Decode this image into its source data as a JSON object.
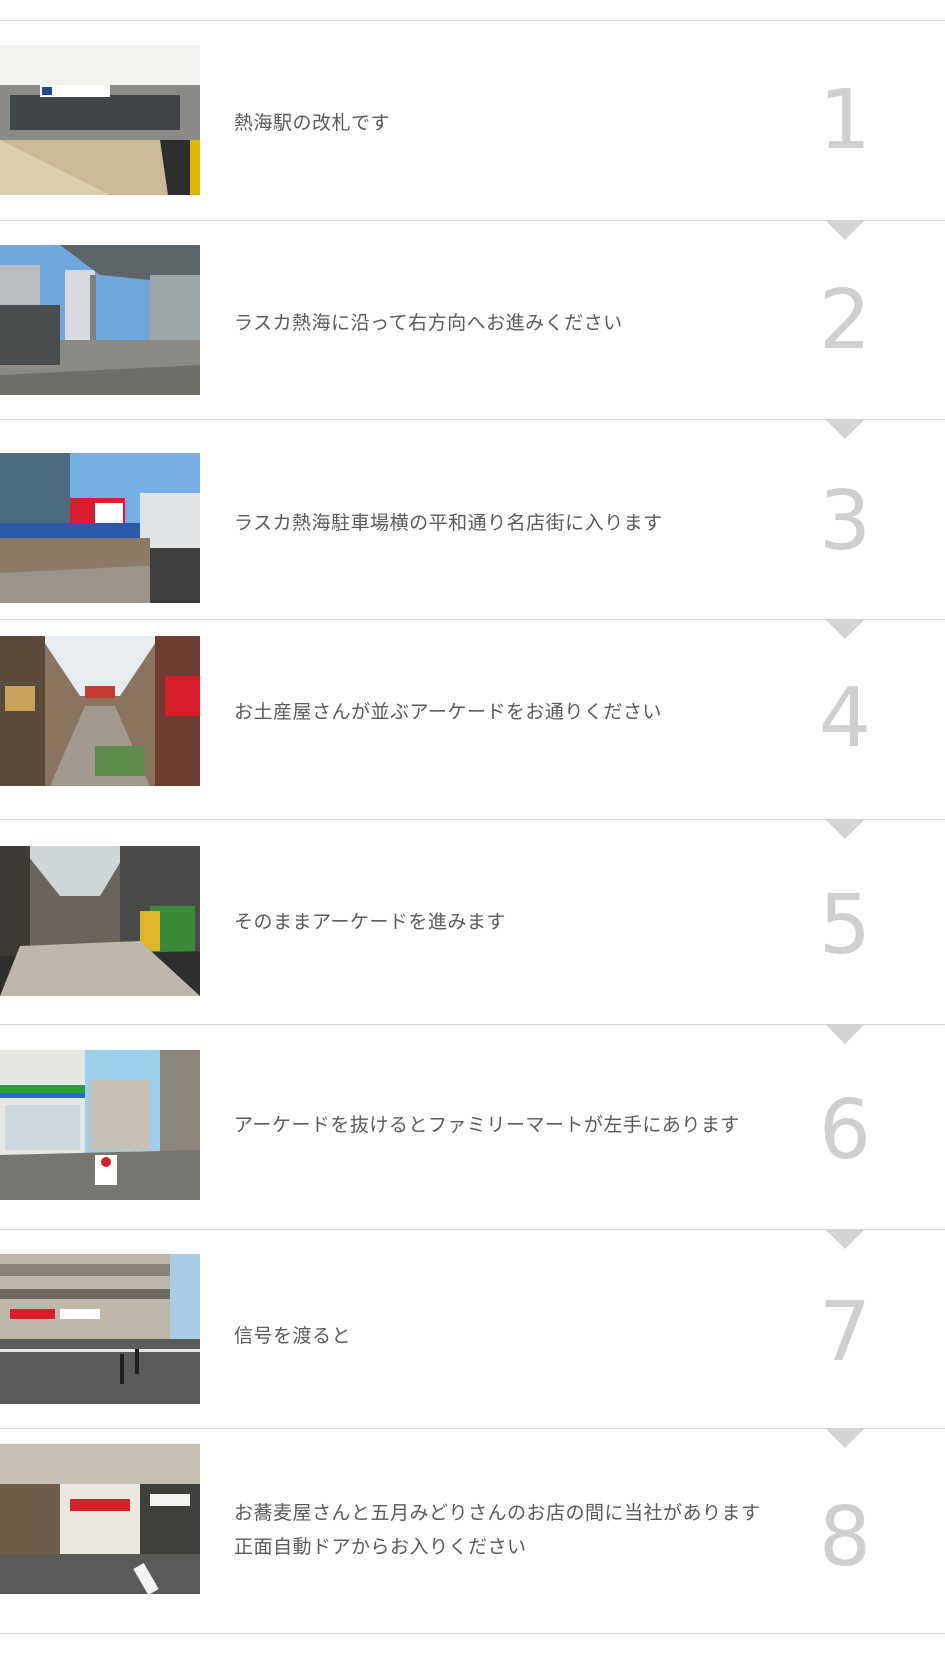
{
  "steps": [
    {
      "number": "1",
      "text": "熱海駅の改札です",
      "photo": "station-ticket-gate-photo"
    },
    {
      "number": "2",
      "text": "ラスカ熱海に沿って右方向へお進みください",
      "photo": "station-walkway-photo"
    },
    {
      "number": "3",
      "text": "ラスカ熱海駐車場横の平和通り名店街に入ります",
      "photo": "shopping-street-entrance-photo"
    },
    {
      "number": "4",
      "text": "お土産屋さんが並ぶアーケードをお通りください",
      "photo": "souvenir-arcade-photo"
    },
    {
      "number": "5",
      "text": "そのままアーケードを進みます",
      "photo": "arcade-continue-photo"
    },
    {
      "number": "6",
      "text": "アーケードを抜けるとファミリーマートが左手にあります",
      "photo": "familymart-corner-photo"
    },
    {
      "number": "7",
      "text": "信号を渡ると",
      "photo": "crosswalk-photo"
    },
    {
      "number": "8",
      "text": "お蕎麦屋さんと五月みどりさんのお店の間に当社があります\n正面自動ドアからお入りください",
      "photo": "office-storefront-photo"
    }
  ],
  "colors": {
    "divider": "#d4d4d4",
    "step_number": "#cfcfcf",
    "text": "#5a5a5a"
  }
}
